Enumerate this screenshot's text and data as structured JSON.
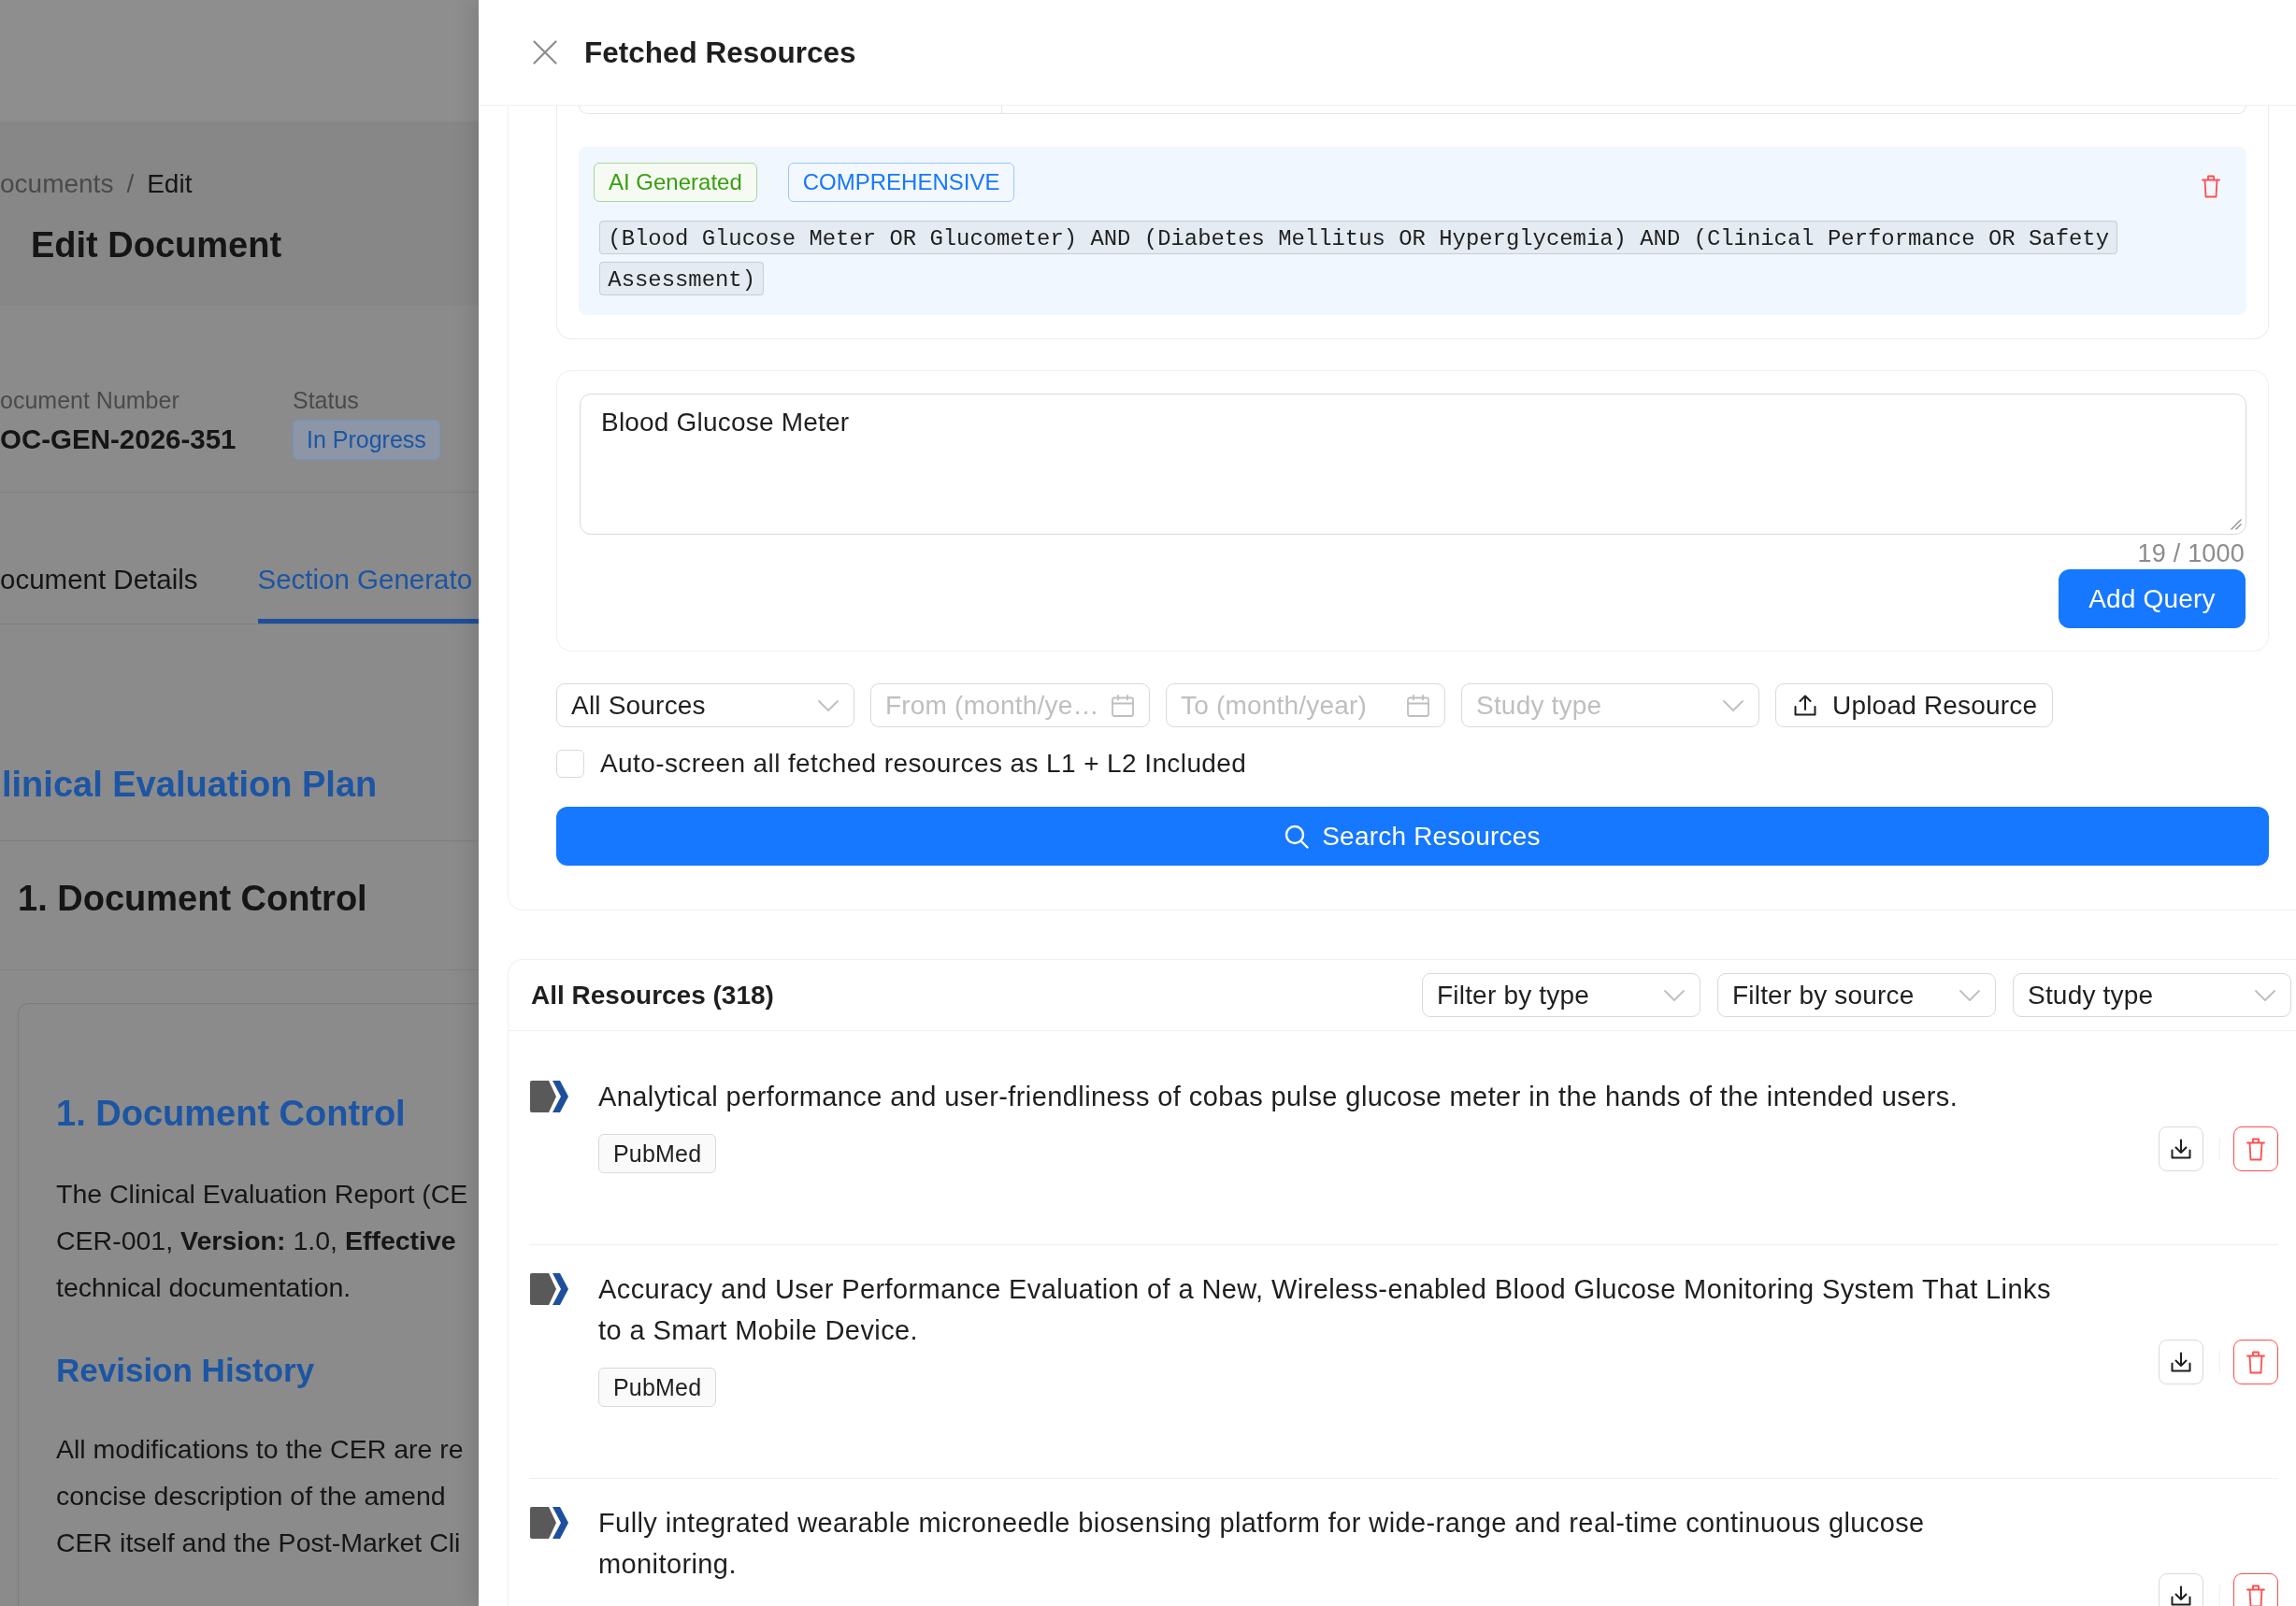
{
  "background_page": {
    "breadcrumb": {
      "items": [
        {
          "label": "ocuments",
          "current": false
        },
        {
          "label": "Edit",
          "current": true
        }
      ],
      "separator": "/"
    },
    "title": "Edit Document",
    "fields": [
      {
        "label": "ocument Number",
        "value": "OC-GEN-2026-351",
        "kind": "text"
      },
      {
        "label": "Status",
        "value": "In Progress",
        "kind": "tag"
      }
    ],
    "tabs": [
      {
        "label": "ocument Details",
        "selected": false
      },
      {
        "label": "Section Generato",
        "selected": true
      }
    ],
    "plan_title": "linical Evaluation Plan",
    "section_title": "1. Document Control",
    "content": [
      {
        "kind": "heading",
        "text": "1. Document Control"
      },
      {
        "kind": "paragraph",
        "lines": [
          "The Clinical Evaluation Report (CE",
          "CER-001, **Version:** 1.0, **Effective**",
          "technical documentation."
        ]
      },
      {
        "kind": "subheading",
        "text": "Revision History"
      },
      {
        "kind": "paragraph",
        "lines": [
          "All modifications to the CER are re",
          "concise description of the amend",
          "CER itself and the Post-Market Cli"
        ]
      }
    ]
  },
  "drawer": {
    "title": "Fetched Resources",
    "queries": [
      {
        "tags": [
          {
            "label": "AI Generated",
            "color": "#389e0d"
          },
          {
            "label": "COMPREHENSIVE",
            "color": "#1677ff"
          }
        ],
        "text": "(Blood Glucose Meter OR Glucometer) AND (Diabetes Mellitus OR Hyperglycemia) AND (Clinical Performance OR Safety Assessment)"
      }
    ],
    "query_input": {
      "value": "Blood Glucose Meter",
      "counter": "19 / 1000"
    },
    "add_query_button": "Add Query",
    "filters": [
      {
        "kind": "select",
        "value": "All Sources"
      },
      {
        "kind": "date",
        "placeholder": "From (month/ye…"
      },
      {
        "kind": "date",
        "placeholder": "To (month/year)"
      },
      {
        "kind": "select",
        "placeholder": "Study type"
      },
      {
        "kind": "upload",
        "label": "Upload Resource"
      }
    ],
    "auto_screen": {
      "label": "Auto-screen all fetched resources as L1 + L2 Included",
      "checked": false
    },
    "search_button": "Search Resources",
    "resources": {
      "title": "All Resources (318)",
      "filters": [
        {
          "value": "Filter by type"
        },
        {
          "value": "Filter by source"
        },
        {
          "value": "Study type"
        }
      ],
      "items": [
        {
          "title": "Analytical performance and user-friendliness of cobas pulse glucose meter in the hands of the intended users.",
          "tags": [
            "PubMed"
          ]
        },
        {
          "title": "Accuracy and User Performance Evaluation of a New, Wireless-enabled Blood Glucose Monitoring System That Links to a Smart Mobile Device.",
          "tags": [
            "PubMed"
          ]
        },
        {
          "title": "Fully integrated wearable microneedle biosensing platform for wide-range and real-time continuous glucose monitoring."
        }
      ]
    }
  }
}
